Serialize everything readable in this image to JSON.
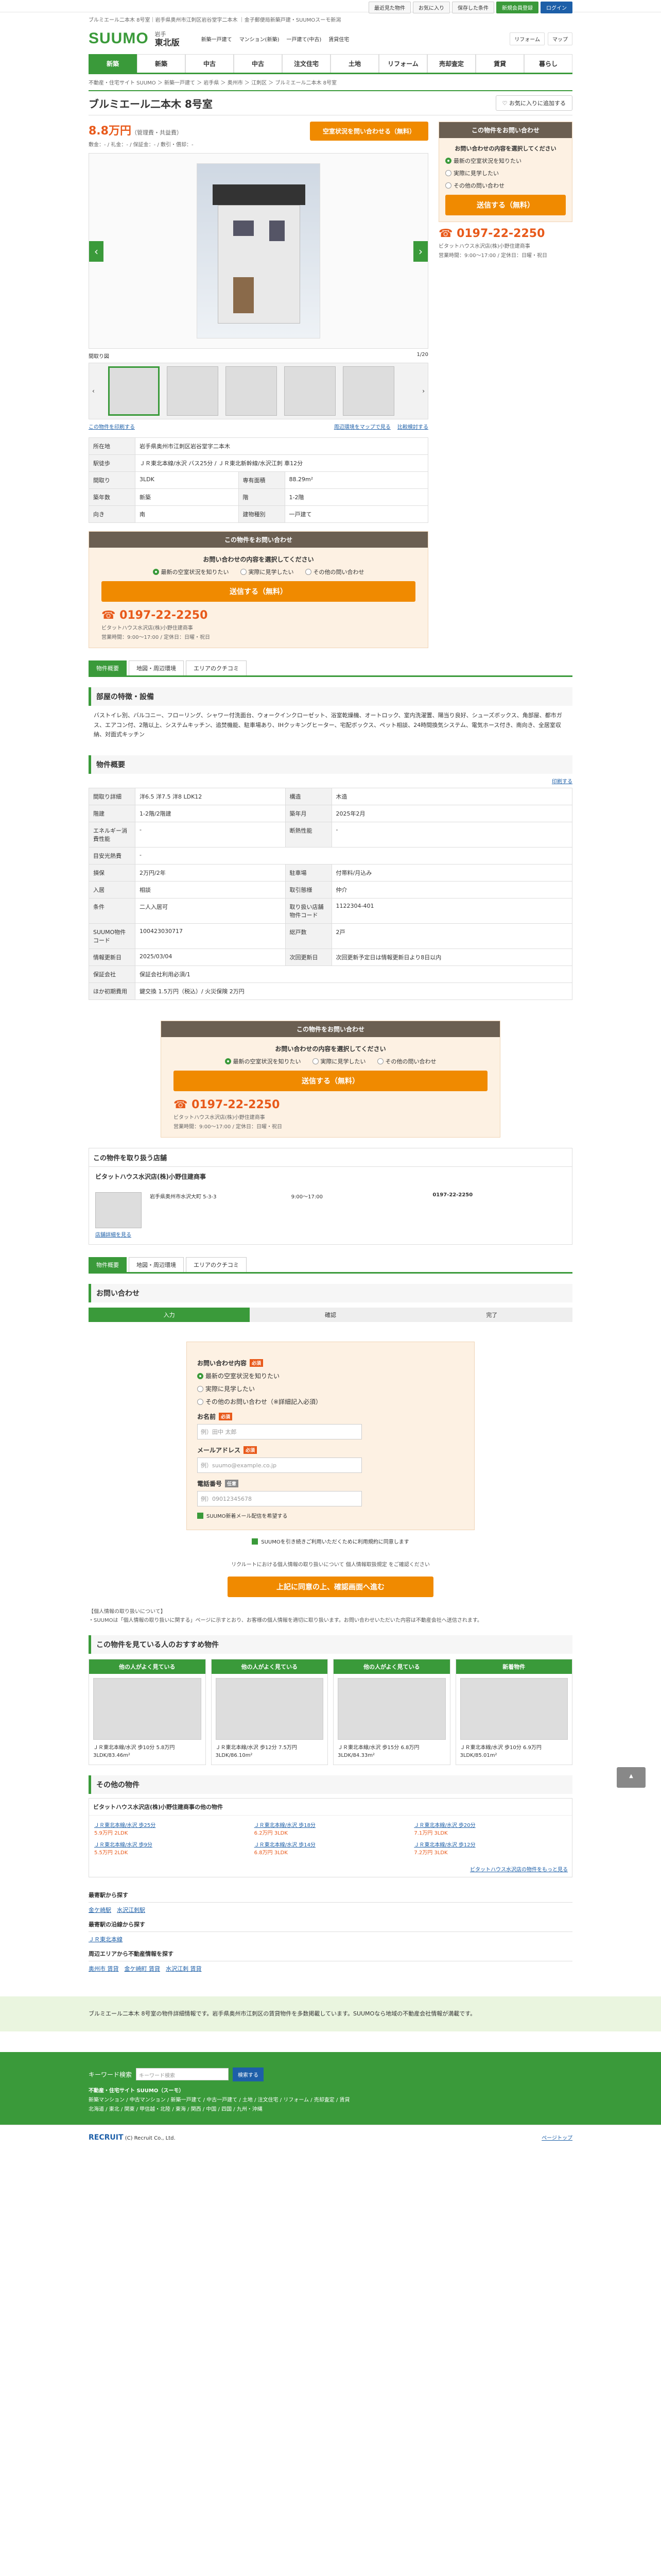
{
  "topbar": {
    "items": [
      "最近見た物件",
      "お気に入り",
      "保存した条件",
      "新規会員登録",
      "ログイン"
    ]
  },
  "header": {
    "desc": "ブルミエール二本木 8号室｜岩手県奥州市江刺区岩谷堂字二本木 ｜金子郵便局新築戸建・SUUMOスーモ新潟",
    "logo": "SUUMO",
    "region_top": "岩手",
    "region_bottom": "東北版",
    "links": [
      "新築一戸建て",
      "マンション(新築)",
      "一戸建て(中古)",
      "賃貸住宅"
    ],
    "badges": [
      "リフォーム",
      "マップ"
    ]
  },
  "nav": [
    "新築",
    "新築",
    "中古",
    "中古",
    "注文住宅",
    "土地",
    "リフォーム",
    "売却査定",
    "賃貸",
    "暮らし"
  ],
  "breadcrumb": "不動産・住宅サイト SUUMO ＞ 新築一戸建て ＞ 岩手県 ＞ 奥州市 ＞ 江刺区 ＞ ブルミエール二本木 8号室",
  "property": {
    "title": "ブルミエール二本木 8号室",
    "fav": "お気に入りに追加する",
    "price": "8.8万円",
    "price_unit": "（管理費・共益費）",
    "price_sub": "敷金：- / 礼金：- / 保証金：- / 敷引・償却：-",
    "inquiry_btn": "空室状況を問い合わせる（無料）",
    "photo_count": "1/20",
    "photo_label": "間取り図",
    "link_print": "この物件を印刷する",
    "link_map": "周辺環境をマップで見る",
    "link_compare": "比較検討する"
  },
  "spec_rows": [
    [
      "所在地",
      "岩手県奥州市江刺区岩谷堂字二本木"
    ],
    [
      "駅徒歩",
      "ＪＲ東北本線/水沢 バス25分 / ＪＲ東北新幹線/水沢江刺 車12分"
    ],
    [
      "間取り",
      "3LDK",
      "専有面積",
      "88.29m²"
    ],
    [
      "築年数",
      "新築",
      "階",
      "1-2階"
    ],
    [
      "向き",
      "南",
      "建物種別",
      "一戸建て"
    ]
  ],
  "inquiry": {
    "header": "この物件をお問い合わせ",
    "question": "お問い合わせの内容を選択してください",
    "opt1": "最新の空室状況を知りたい",
    "opt2": "実際に見学したい",
    "opt3": "その他の問い合わせ",
    "submit": "送信する（無料）",
    "tel": "0197-22-2250",
    "tel_company": "ビタットハウス水沢店(株)小野住建商事",
    "tel_hours": "営業時間：9:00～17:00 / 定休日：日曜・祝日"
  },
  "tabs": [
    "物件概要",
    "地図・周辺環境",
    "エリアのクチコミ"
  ],
  "features": {
    "heading": "部屋の特徴・設備",
    "text": "バストイレ別、バルコニー、フローリング、シャワー付洗面台、ウォークインクローゼット、浴室乾燥機、オートロック、室内洗濯置、陽当り良好、シューズボックス、角部屋、都市ガス、エアコン付、2階以上、システムキッチン、追焚機能、駐車場あり、IHクッキングヒーター、宅配ボックス、ペット相談、24時間換気システム、電気ホース付き、南向き、全居室収納、対面式キッチン"
  },
  "overview": {
    "heading": "物件概要",
    "print": "印刷する",
    "rows": [
      [
        "間取り詳細",
        "洋6.5 洋7.5 洋8 LDK12",
        "構造",
        "木造"
      ],
      [
        "階建",
        "1-2階/2階建",
        "築年月",
        "2025年2月"
      ],
      [
        "エネルギー消費性能",
        "-",
        "断熱性能",
        "-"
      ],
      [
        "目安光熱費",
        "-",
        "",
        ""
      ],
      [
        "損保",
        "2万円/2年",
        "駐車場",
        "付帯料/月込み"
      ],
      [
        "入居",
        "相談",
        "取引態様",
        "仲介"
      ],
      [
        "条件",
        "二人入居可",
        "取り扱い店舗物件コード",
        "1122304-401"
      ],
      [
        "SUUMO物件コード",
        "100423030717",
        "総戸数",
        "2戸"
      ],
      [
        "情報更新日",
        "2025/03/04",
        "次回更新日",
        "次回更新予定日は情報更新日より8日以内"
      ],
      [
        "保証会社",
        "保証会社利用必須/1"
      ],
      [
        "ほか初期費用",
        "鍵交換 1.5万円（税込）/ 火災保険 2万円"
      ]
    ]
  },
  "company": {
    "heading": "この物件を取り扱う店舗",
    "name": "ビタットハウス水沢店(株)小野住建商事",
    "addr": "岩手県奥州市水沢大町 5-3-3",
    "hours": "9:00～17:00",
    "tel": "0197-22-2250",
    "link": "店舗詳細を見る"
  },
  "form": {
    "heading": "お問い合わせ",
    "step1": "入力",
    "step2": "確認",
    "step3": "完了",
    "label_content": "お問い合わせ内容",
    "o1": "最新の空室状況を知りたい",
    "o2": "実際に見学したい",
    "o3": "その他のお問い合わせ（※詳細記入必須）",
    "label_name": "お名前",
    "name_ph": "例）田中 太郎",
    "label_mail": "メールアドレス",
    "mail_ph": "例）suumo@example.co.jp",
    "label_tel": "電話番号",
    "tel_ph": "例）09012345678",
    "agree1": "SUUMO新着メール配信を希望する",
    "agree2": "SUUMOを引き続きご利用いただくために利用規約に同意します",
    "privacy": "リクルートにおける個人情報の取り扱いについて 個人情報取扱規定 をご確認ください",
    "submit": "上記に同意の上、確認画面へ進む",
    "note_head": "【個人情報の取り扱いについて】",
    "note": "・SUUMOは「個人情報の取り扱いに関する」ページに示すとおり、お客様の個人情報を適切に取り扱います。お問い合わせいただいた内容は不動産会社へ送信されます。"
  },
  "recommend": {
    "heading": "この物件を見ている人のおすすめ物件",
    "heads": [
      "他の人がよく見ている",
      "他の人がよく見ている",
      "他の人がよく見ている",
      "新着物件"
    ],
    "items": [
      "ＪＲ東北本線/水沢 歩10分 5.8万円 3LDK/83.46m²",
      "ＪＲ東北本線/水沢 歩12分 7.5万円 3LDK/86.10m²",
      "ＪＲ東北本線/水沢 歩15分 6.8万円 3LDK/84.33m²",
      "ＪＲ東北本線/水沢 歩10分 6.9万円 3LDK/85.01m²"
    ]
  },
  "others": {
    "heading": "その他の物件",
    "sub": "ビタットハウス水沢店(株)小野住建商事の他の物件",
    "list": [
      [
        "ＪＲ東北本線/水沢 歩25分",
        "5.9万円 2LDK"
      ],
      [
        "ＪＲ東北本線/水沢 歩18分",
        "6.2万円 3LDK"
      ],
      [
        "ＪＲ東北本線/水沢 歩20分",
        "7.1万円 3LDK"
      ],
      [
        "ＪＲ東北本線/水沢 歩9分",
        "5.5万円 2LDK"
      ],
      [
        "ＪＲ東北本線/水沢 歩14分",
        "6.8万円 3LDK"
      ],
      [
        "ＪＲ東北本線/水沢 歩12分",
        "7.2万円 3LDK"
      ]
    ],
    "more": "ビタットハウス水沢店の物件をもっと見る"
  },
  "area": {
    "h1": "最寄駅から探す",
    "l1": [
      "金ケ崎駅",
      "水沢江刺駅"
    ],
    "h2": "最寄駅の沿線から探す",
    "l2": [
      "ＪＲ東北本線"
    ],
    "h3": "周辺エリアから不動産情報を探す",
    "l3": [
      "奥州市 賃貸",
      "金ケ崎町 賃貸",
      "水沢江刺 賃貸"
    ]
  },
  "footer": {
    "info": "ブルミエール二本木 8号室の物件詳細情報です。岩手県奥州市江刺区の賃貸物件を多数掲載しています。SUUMOなら地域の不動産会社情報が満載です。",
    "search_label": "キーワード検索",
    "search_ph": "キーワード検索",
    "search_btn": "検索する",
    "site": "不動産・住宅サイト SUUMO（スーモ）",
    "links1": "新築マンション / 中古マンション / 新築一戸建て / 中古一戸建て / 土地 / 注文住宅 / リフォーム / 売却査定 / 賃貸",
    "links2": "北海道 / 東北 / 関東 / 甲信越・北陸 / 東海 / 関西 / 中国 / 四国 / 九州・沖縄",
    "company": "RECRUIT",
    "copyright": "(C) Recruit Co., Ltd.",
    "pagetop": "ページトップ"
  }
}
